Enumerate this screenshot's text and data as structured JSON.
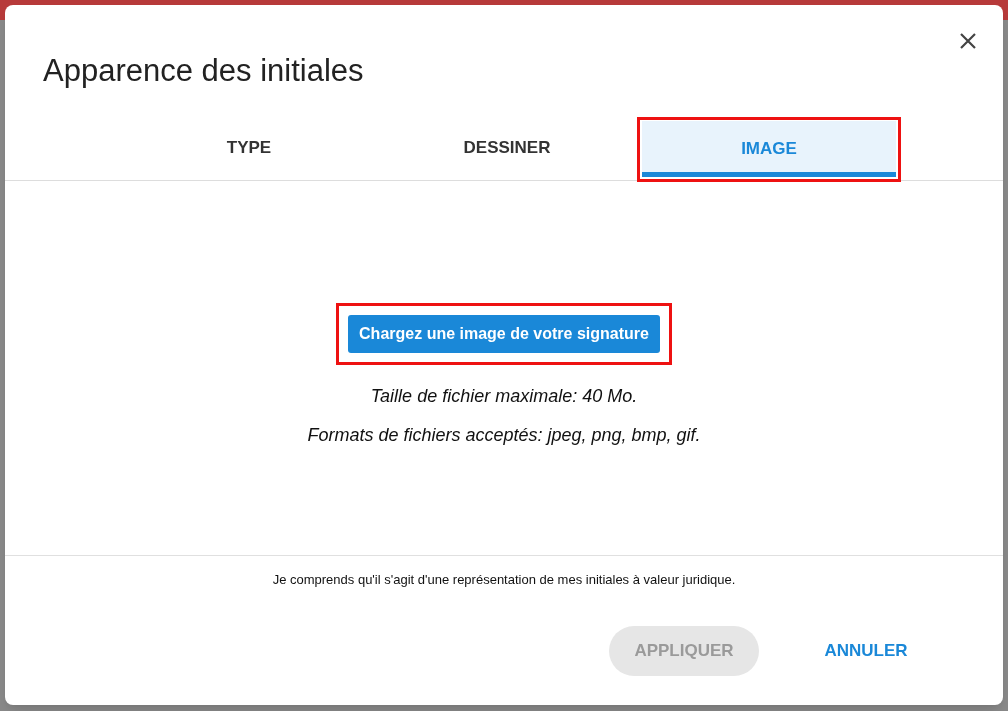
{
  "dialog": {
    "title": "Apparence des initiales",
    "tabs": [
      {
        "label": "TYPE",
        "selected": false,
        "highlighted": false
      },
      {
        "label": "DESSINER",
        "selected": false,
        "highlighted": false
      },
      {
        "label": "IMAGE",
        "selected": true,
        "highlighted": true
      }
    ],
    "upload_button": {
      "label": "Chargez une image de votre signature",
      "highlighted": true
    },
    "notes": [
      "Taille de fichier maximale: 40 Mo.",
      "Formats de fichiers acceptés: jpeg, png, bmp, gif."
    ],
    "disclaimer": "Je comprends qu'il s'agit d'une représentation de mes initiales à valeur juridique.",
    "buttons": [
      {
        "label": "APPLIQUER",
        "disabled": true
      },
      {
        "label": "ANNULER",
        "disabled": false
      }
    ]
  }
}
